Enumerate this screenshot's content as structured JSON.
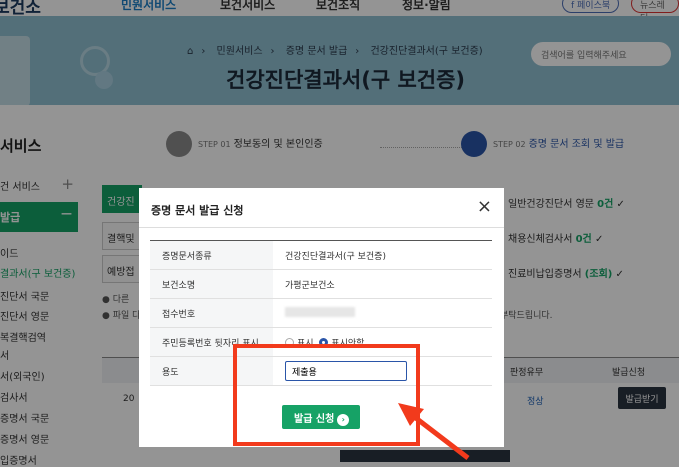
{
  "nav": {
    "logo": "보건소",
    "menu": [
      "민원서비스",
      "보건서비스",
      "보건조직",
      "정보·알림"
    ],
    "sns": [
      "페이스북",
      "뉴스레터"
    ]
  },
  "banner": {
    "breadcrumb": [
      "민원서비스",
      "증명 문서 발급",
      "건강진단결과서(구 보건증)"
    ],
    "title": "건강진단결과서(구 보건증)",
    "search_placeholder": "검색어를 입력해주세요"
  },
  "sidebar": {
    "title": "서비스",
    "items": [
      "건 서비스",
      "발급",
      "이드",
      "결과서(구 보건증)",
      "진단서 국문",
      "진단서 영문",
      "복결핵검역",
      "서",
      "서(외국인)",
      "검사서",
      "증명서 국문",
      "증명서 영문",
      "입증명서"
    ]
  },
  "steps": [
    {
      "num": "STEP 01",
      "label": "정보동의 및 본인인증"
    },
    {
      "num": "STEP 02",
      "label": "증명 문서 조회 및 발급"
    }
  ],
  "left_buttons": [
    "건강진",
    "결핵및",
    "예방접"
  ],
  "right_items": [
    {
      "label": "일반건강진단서 영문",
      "count": "0건"
    },
    {
      "label": "채용신체검사서",
      "count": "0건"
    },
    {
      "label": "진료비납입증명서",
      "count": "(조회)"
    }
  ],
  "notes": [
    "다른",
    "파일 다"
  ],
  "note_right": "부탁드립니다.",
  "table": {
    "headers": [
      "판정유무",
      "발급신청"
    ],
    "row": {
      "date": "20",
      "status": "정상",
      "action": "발급받기"
    }
  },
  "modal": {
    "title": "증명 문서 발급 신청",
    "close": "×",
    "rows": [
      {
        "label": "증명문서종류",
        "value": "건강진단결과서(구 보건증)"
      },
      {
        "label": "보건소명",
        "value": "가평군보건소"
      },
      {
        "label": "접수번호",
        "value": ""
      },
      {
        "label": "주민등록번호 뒷자리 표시",
        "options": [
          "표시",
          "표시안함"
        ],
        "selected": "표시안함"
      },
      {
        "label": "용도",
        "input_value": "제출용"
      }
    ],
    "submit": "발급 신청"
  },
  "annotation": {
    "color": "#f23a1c"
  }
}
